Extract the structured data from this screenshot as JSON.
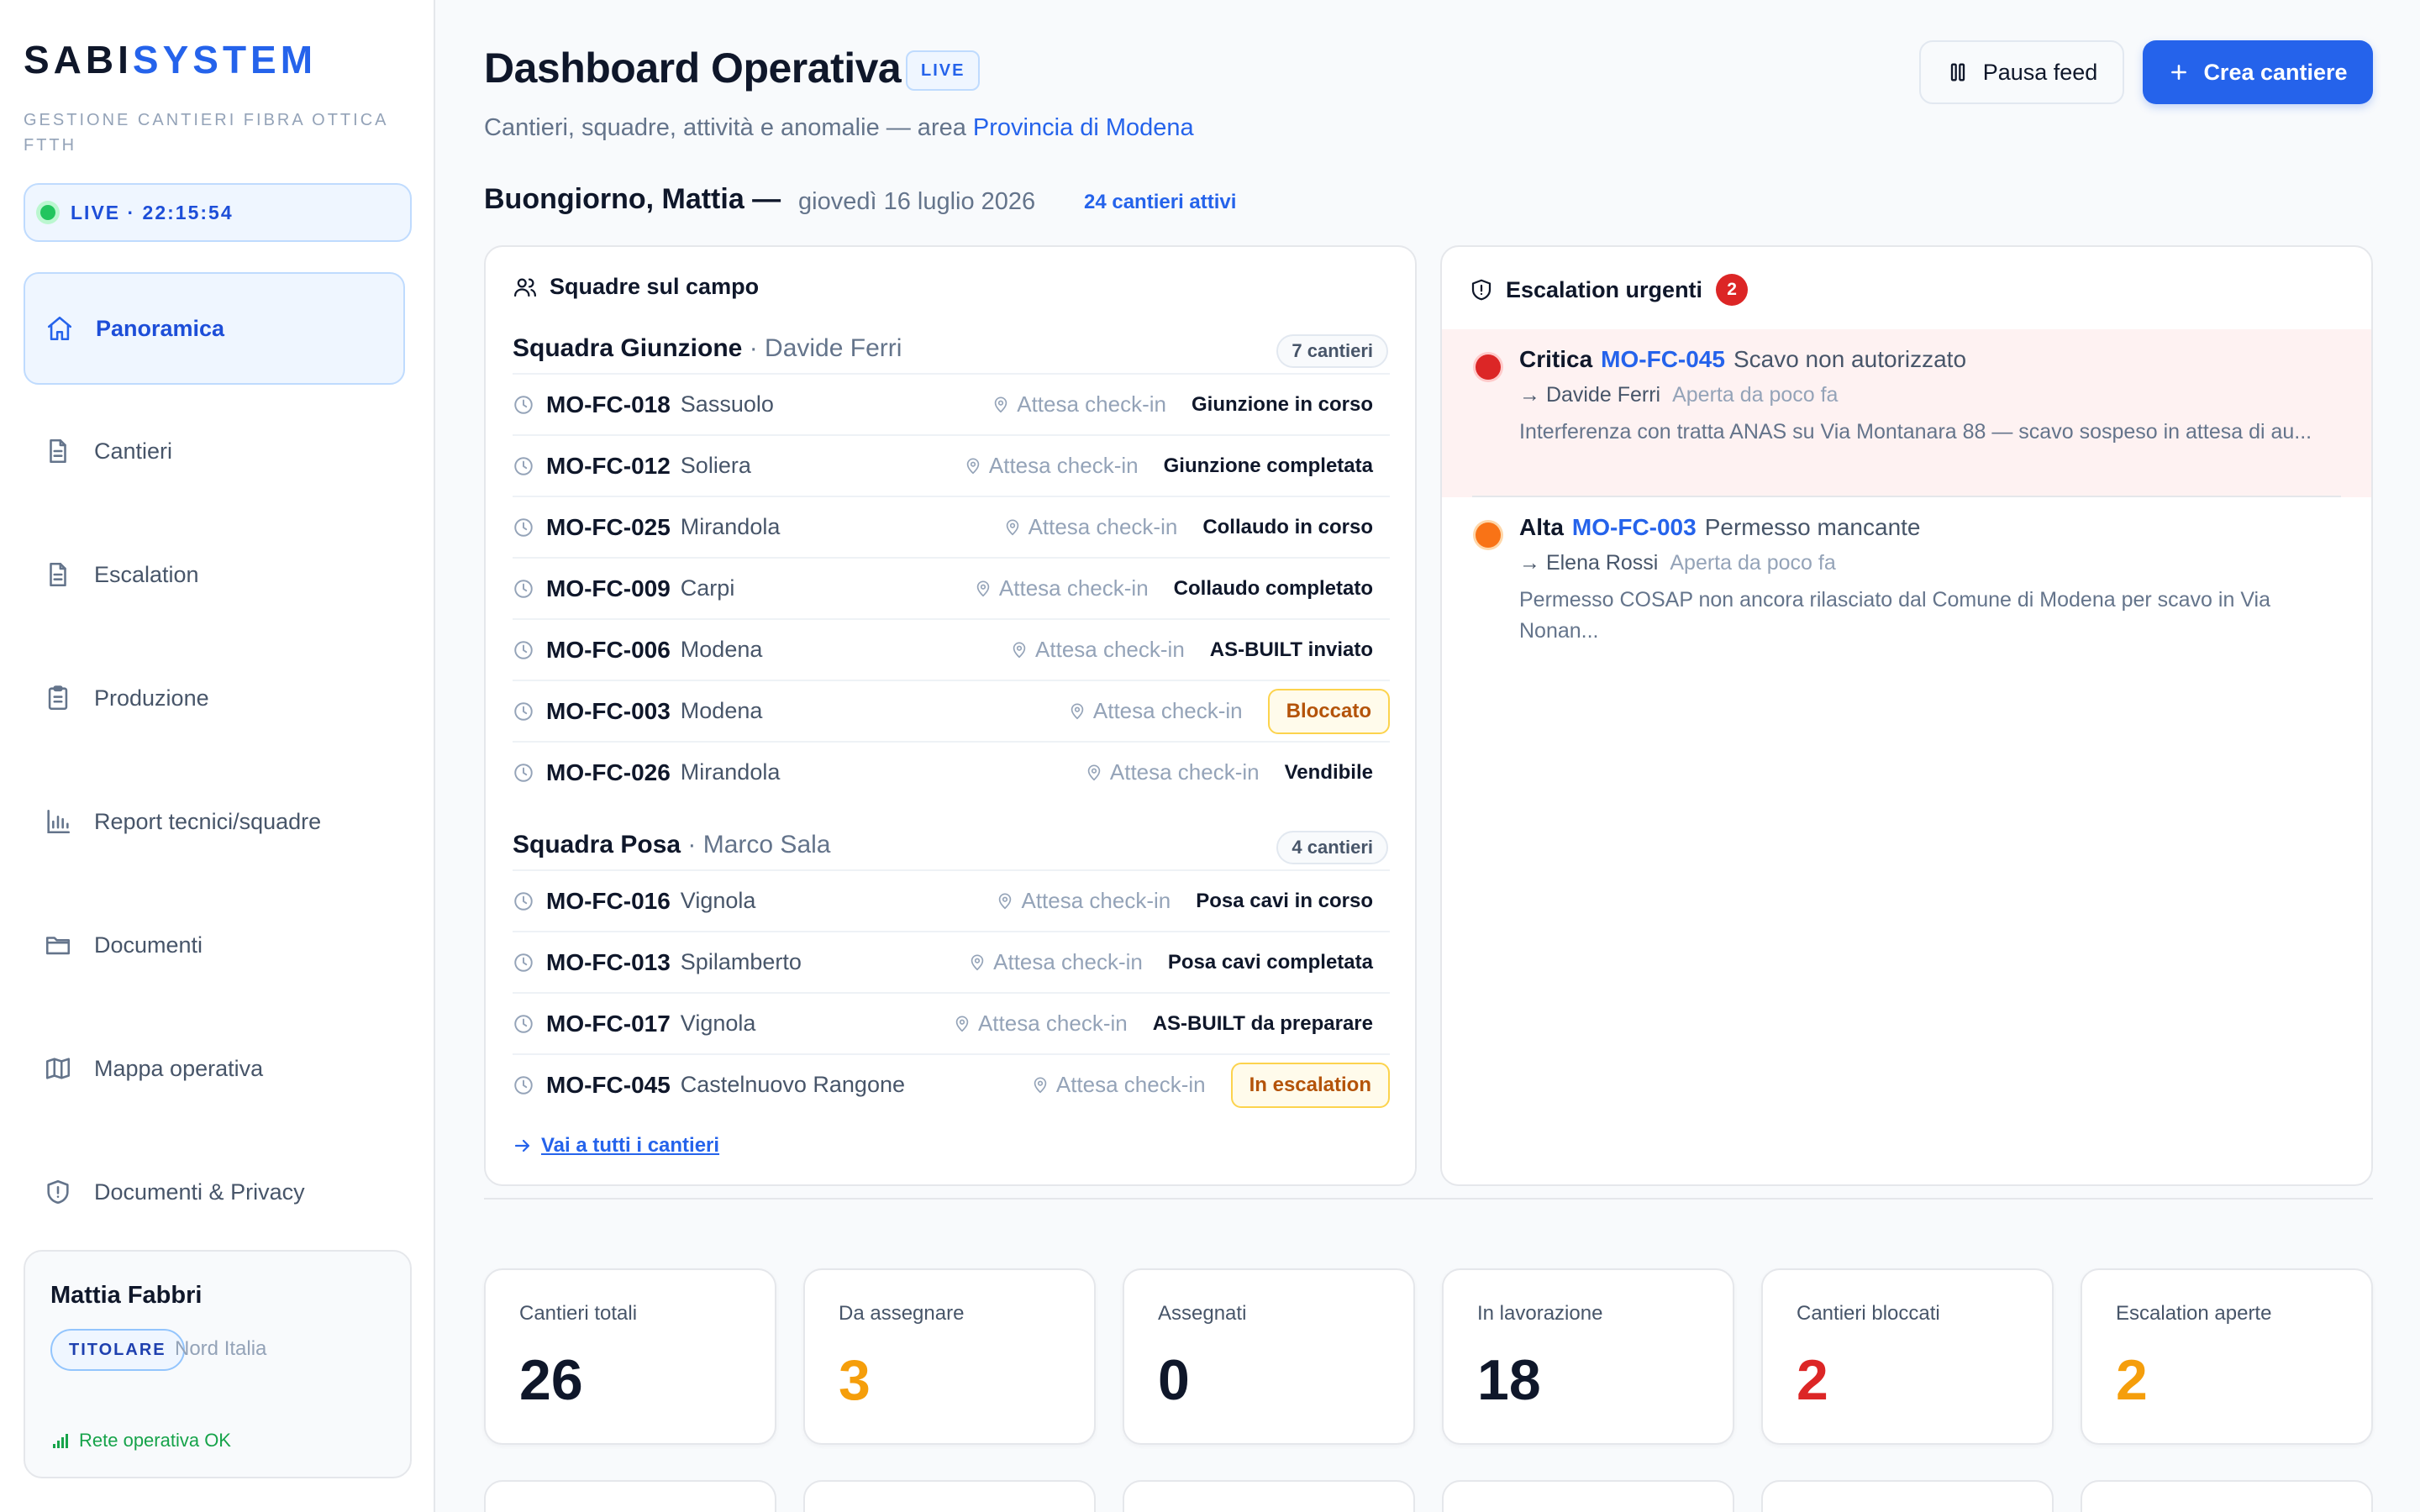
{
  "brand": {
    "name_a": "SABI",
    "name_b": "SYSTEM",
    "tagline": "GESTIONE CANTIERI FIBRA OTTICA FTTH"
  },
  "live_clock": "LIVE · 22:15:54",
  "sidebar": {
    "items": [
      {
        "label": "Panoramica",
        "icon": "home-icon",
        "active": true
      },
      {
        "label": "Cantieri",
        "icon": "document-icon"
      },
      {
        "label": "Escalation",
        "icon": "document-icon"
      },
      {
        "label": "Produzione",
        "icon": "clipboard-icon"
      },
      {
        "label": "Report tecnici/squadre",
        "icon": "bar-chart-icon"
      },
      {
        "label": "Documenti",
        "icon": "folder-icon"
      },
      {
        "label": "Mappa operativa",
        "icon": "map-icon"
      },
      {
        "label": "Documenti & Privacy",
        "icon": "shield-icon"
      }
    ]
  },
  "user": {
    "name": "Mattia Fabbri",
    "role": "TITOLARE",
    "region": "Nord Italia",
    "network": "Rete operativa OK"
  },
  "header": {
    "title": "Dashboard Operativa",
    "badge": "LIVE",
    "subtitle": "Cantieri, squadre, attività e anomalie — area",
    "area": "Provincia di Modena",
    "pause_label": "Pausa feed",
    "create_label": "Crea cantiere"
  },
  "greeting": {
    "text": "Buongiorno, Mattia —",
    "date": "giovedì 16 luglio 2026",
    "active": "24 cantieri attivi"
  },
  "squads_panel": {
    "title": "Squadre sul campo",
    "checkin": "Attesa check-in",
    "see_all": "Vai a tutti i cantieri",
    "squads": [
      {
        "name": "Squadra Giunzione",
        "lead": "· Davide Ferri",
        "count": "7 cantieri",
        "rows": [
          {
            "code": "MO-FC-018",
            "city": "Sassuolo",
            "status": "Giunzione in corso"
          },
          {
            "code": "MO-FC-012",
            "city": "Soliera",
            "status": "Giunzione completata"
          },
          {
            "code": "MO-FC-025",
            "city": "Mirandola",
            "status": "Collaudo in corso"
          },
          {
            "code": "MO-FC-009",
            "city": "Carpi",
            "status": "Collaudo completato"
          },
          {
            "code": "MO-FC-006",
            "city": "Modena",
            "status": "AS-BUILT inviato"
          },
          {
            "code": "MO-FC-003",
            "city": "Modena",
            "status": "Bloccato"
          },
          {
            "code": "MO-FC-026",
            "city": "Mirandola",
            "status": "Vendibile"
          }
        ]
      },
      {
        "name": "Squadra Posa",
        "lead": "· Marco Sala",
        "count": "4 cantieri",
        "rows": [
          {
            "code": "MO-FC-016",
            "city": "Vignola",
            "status": "Posa cavi in corso"
          },
          {
            "code": "MO-FC-013",
            "city": "Spilamberto",
            "status": "Posa cavi completata"
          },
          {
            "code": "MO-FC-017",
            "city": "Vignola",
            "status": "AS-BUILT da preparare"
          },
          {
            "code": "MO-FC-045",
            "city": "Castelnuovo Rangone",
            "status": "In escalation"
          }
        ]
      }
    ]
  },
  "escalation_panel": {
    "title": "Escalation urgenti",
    "count": "2",
    "items": [
      {
        "severity": "Critica",
        "code": "MO-FC-045",
        "issue": "Scavo non autorizzato",
        "assignee": "→ Davide Ferri",
        "opened": "Aperta da poco fa",
        "description": "Interferenza con tratta ANAS su Via Montanara 88 — scavo sospeso in attesa di au...",
        "color": "#dc2626"
      },
      {
        "severity": "Alta",
        "code": "MO-FC-003",
        "issue": "Permesso mancante",
        "assignee": "→ Elena Rossi",
        "opened": "Aperta da poco fa",
        "description": "Permesso COSAP non ancora rilasciato dal Comune di Modena per scavo in Via Nonan...",
        "color": "#f97316"
      }
    ]
  },
  "kpis": [
    {
      "label": "Cantieri totali",
      "value": "26",
      "color": "#0f172a"
    },
    {
      "label": "Da assegnare",
      "value": "3",
      "color": "#f59e0b"
    },
    {
      "label": "Assegnati",
      "value": "0",
      "color": "#0f172a"
    },
    {
      "label": "In lavorazione",
      "value": "18",
      "color": "#0f172a"
    },
    {
      "label": "Cantieri bloccati",
      "value": "2",
      "color": "#dc2626"
    },
    {
      "label": "Escalation aperte",
      "value": "2",
      "color": "#f59e0b"
    }
  ]
}
